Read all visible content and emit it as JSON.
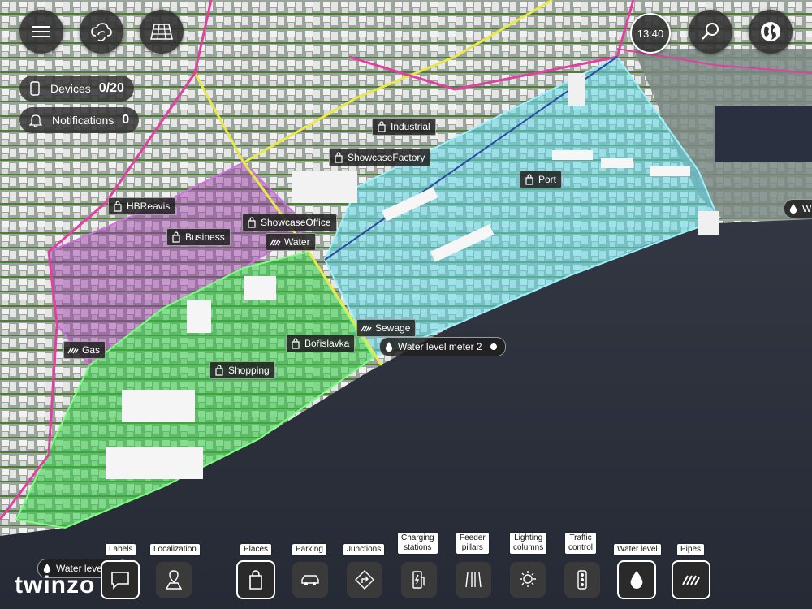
{
  "top_buttons": {
    "menu_icon": "menu-icon",
    "sync_icon": "cloud-sync-icon",
    "grid_icon": "grid-icon",
    "clock_time": "13:40",
    "search_icon": "search-icon",
    "globe_icon": "globe-icon"
  },
  "info": {
    "devices_label": "Devices",
    "devices_value": "0/20",
    "notifications_label": "Notifications",
    "notifications_value": "0"
  },
  "map_tags": {
    "industrial": "Industrial",
    "showcase_factory": "ShowcaseFactory",
    "port": "Port",
    "hbreavis": "HBReavis",
    "business": "Business",
    "showcase_office": "ShowcaseOffice",
    "water": "Water",
    "sewage": "Sewage",
    "water_level_meter": "Water level meter 2",
    "borislavka": "Bořislavka",
    "shopping": "Shopping",
    "gas": "Gas",
    "edge_tag": "W",
    "bottom_water_level": "Water level"
  },
  "toolbar": {
    "labels": "Labels",
    "localization": "Localization",
    "places": "Places",
    "parking": "Parking",
    "junctions": "Junctions",
    "charging_line1": "Charging",
    "charging_line2": "stations",
    "feeder_line1": "Feeder",
    "feeder_line2": "pillars",
    "lighting_line1": "Lighting",
    "lighting_line2": "columns",
    "traffic_line1": "Traffic",
    "traffic_line2": "control",
    "water_level": "Water level",
    "pipes": "Pipes"
  },
  "logo": "twinzo",
  "colors": {
    "accent_water": "#5fd7e6",
    "business_zone": "#9b3fa8",
    "shopping_zone": "#2ecc40",
    "road_yellow": "#e8e84a",
    "road_pink": "#e040a0"
  }
}
